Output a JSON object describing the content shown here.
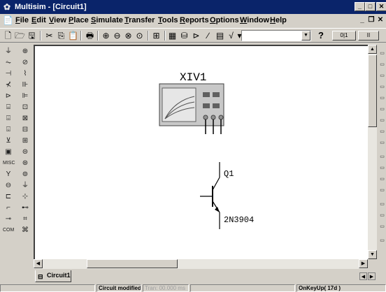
{
  "window": {
    "title": "Multisim - [Circuit1]",
    "controls": {
      "minimize": "_",
      "maximize": "□",
      "close": "✕"
    }
  },
  "menu": {
    "items": [
      "File",
      "Edit",
      "View",
      "Place",
      "Simulate",
      "Transfer",
      "Tools",
      "Reports",
      "Options",
      "Window",
      "Help"
    ],
    "mdi": {
      "minimize": "_",
      "restore": "❐",
      "close": "✕"
    }
  },
  "toolbar": {
    "icons": [
      "new-icon",
      "open-icon",
      "save-icon",
      "cut-icon",
      "copy-icon",
      "paste-icon",
      "print-icon",
      "zoom-in-icon",
      "zoom-out-icon",
      "zoom-area-icon",
      "zoom-fit-icon",
      "hierarchy-icon",
      "spreadsheet-icon",
      "database-icon",
      "component-icon",
      "wire-icon",
      "postprocessor-icon",
      "grapher-icon",
      "description-icon"
    ],
    "combo_value": "",
    "help_label": "?",
    "run_label": "0|1",
    "pause_label": "II"
  },
  "schematic": {
    "instrument": {
      "ref": "XIV1",
      "type": "IV analyzer"
    },
    "transistor": {
      "ref": "Q1",
      "value": "2N3904"
    }
  },
  "tabs": [
    {
      "label": "Circuit1"
    }
  ],
  "status": {
    "panes": [
      "",
      "Circuit modified",
      "Tran: 00.000 ms",
      "",
      "OnKeyUp( 17d )"
    ]
  },
  "colors": {
    "titlebar": "#0a246a",
    "face": "#d4d0c8",
    "canvas": "#ffffff",
    "instrument_body": "#c8c8c8",
    "instrument_screen": "#e6e6e6"
  }
}
